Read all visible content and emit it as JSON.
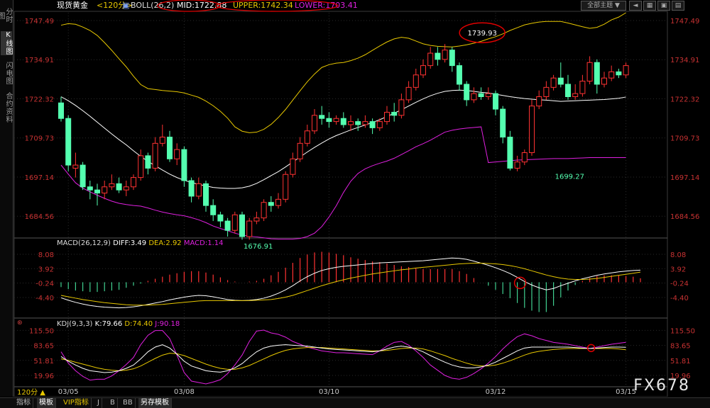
{
  "sidebar": {
    "tabs": [
      {
        "label": "分时图",
        "active": false
      },
      {
        "label": "K线图",
        "active": true
      },
      {
        "label": "闪电图",
        "active": false
      },
      {
        "label": "合约资料",
        "active": false
      }
    ]
  },
  "header": {
    "symbol": "现货黄金",
    "period": "<120分>",
    "indicator": "BOLL(26,2)",
    "mid": "MID:1722.88",
    "upper": "UPPER:1742.34",
    "lower": "LOWER:1703.41",
    "theme_select": "全部主题",
    "colors": {
      "mid": "#ffffff",
      "upper": "#e8c800",
      "lower": "#e020e0",
      "highlight": "#e00000"
    }
  },
  "macd_header": {
    "name": "MACD(26,12,9)",
    "diff": "DIFF:3.49",
    "dea": "DEA:2.92",
    "macd": "MACD:1.14"
  },
  "kdj_header": {
    "name": "KDJ(9,3,3)",
    "k": "K:79.66",
    "d": "D:74.40",
    "j": "J:90.18"
  },
  "bottom": {
    "period_label": "120分",
    "tabs": [
      "指标",
      "模板",
      "VIP指标",
      "J",
      "B",
      "BB",
      "另存模板"
    ]
  },
  "watermark": "FX678",
  "chart_data": [
    {
      "type": "candlestick",
      "title": "现货黄金 <120分> BOLL(26,2)",
      "yticks": [
        "1747.49",
        "1734.91",
        "1722.32",
        "1709.73",
        "1697.14",
        "1684.56"
      ],
      "ylim": [
        1678,
        1750
      ],
      "xticks": [
        {
          "label": "03/05",
          "index": 1
        },
        {
          "label": "03/08",
          "index": 17
        },
        {
          "label": "03/10",
          "index": 37
        },
        {
          "label": "03/12",
          "index": 60
        },
        {
          "label": "03/15",
          "index": 78
        }
      ],
      "annotations": [
        {
          "text": "1739.93",
          "index": 56,
          "value": 1739.93,
          "circled": true
        },
        {
          "text": "1699.27",
          "index": 68,
          "value": 1699.27
        },
        {
          "text": "1676.91",
          "index": 25,
          "value": 1676.91
        }
      ],
      "candles": [
        [
          1721,
          1716,
          1723,
          1715
        ],
        [
          1716,
          1701,
          1717,
          1699
        ],
        [
          1700,
          1701,
          1705,
          1697
        ],
        [
          1701,
          1694,
          1702,
          1693
        ],
        [
          1694,
          1693,
          1696,
          1690
        ],
        [
          1693,
          1692,
          1695,
          1688
        ],
        [
          1692,
          1694,
          1696,
          1690
        ],
        [
          1694,
          1695,
          1698,
          1693
        ],
        [
          1695,
          1693,
          1697,
          1692
        ],
        [
          1693,
          1694,
          1696,
          1691
        ],
        [
          1694,
          1697,
          1698,
          1693
        ],
        [
          1697,
          1704,
          1706,
          1696
        ],
        [
          1704,
          1700,
          1705,
          1698
        ],
        [
          1700,
          1708,
          1710,
          1699
        ],
        [
          1708,
          1710,
          1714,
          1707
        ],
        [
          1710,
          1703,
          1712,
          1702
        ],
        [
          1703,
          1706,
          1708,
          1701
        ],
        [
          1706,
          1696,
          1707,
          1694
        ],
        [
          1696,
          1691,
          1697,
          1689
        ],
        [
          1691,
          1695,
          1697,
          1690
        ],
        [
          1695,
          1688,
          1696,
          1686
        ],
        [
          1688,
          1685,
          1690,
          1683
        ],
        [
          1685,
          1683,
          1686,
          1681
        ],
        [
          1683,
          1680,
          1684,
          1678
        ],
        [
          1680,
          1685,
          1686,
          1679
        ],
        [
          1685,
          1678,
          1686,
          1677
        ],
        [
          1678,
          1683,
          1684,
          1677
        ],
        [
          1683,
          1684,
          1686,
          1682
        ],
        [
          1684,
          1689,
          1690,
          1683
        ],
        [
          1689,
          1688,
          1691,
          1686
        ],
        [
          1688,
          1690,
          1692,
          1687
        ],
        [
          1690,
          1698,
          1699,
          1689
        ],
        [
          1698,
          1703,
          1705,
          1697
        ],
        [
          1703,
          1708,
          1710,
          1702
        ],
        [
          1708,
          1712,
          1714,
          1707
        ],
        [
          1712,
          1717,
          1719,
          1711
        ],
        [
          1717,
          1716,
          1720,
          1714
        ],
        [
          1716,
          1715,
          1718,
          1713
        ],
        [
          1715,
          1716,
          1717,
          1714
        ],
        [
          1716,
          1714,
          1718,
          1713
        ],
        [
          1714,
          1715,
          1717,
          1712
        ],
        [
          1715,
          1714,
          1716,
          1712
        ],
        [
          1714,
          1715,
          1717,
          1713
        ],
        [
          1715,
          1713,
          1716,
          1711
        ],
        [
          1713,
          1715,
          1716,
          1712
        ],
        [
          1715,
          1718,
          1720,
          1714
        ],
        [
          1718,
          1717,
          1721,
          1715
        ],
        [
          1717,
          1722,
          1724,
          1716
        ],
        [
          1722,
          1726,
          1728,
          1721
        ],
        [
          1726,
          1730,
          1732,
          1725
        ],
        [
          1730,
          1733,
          1735,
          1729
        ],
        [
          1733,
          1737,
          1739,
          1732
        ],
        [
          1737,
          1735,
          1739,
          1733
        ],
        [
          1735,
          1738,
          1739.93,
          1734
        ],
        [
          1738,
          1733,
          1739,
          1731
        ],
        [
          1733,
          1727,
          1734,
          1725
        ],
        [
          1727,
          1722,
          1728,
          1720
        ],
        [
          1722,
          1724,
          1726,
          1721
        ],
        [
          1724,
          1723,
          1726,
          1722
        ],
        [
          1723,
          1724,
          1726,
          1722
        ],
        [
          1724,
          1719,
          1725,
          1717
        ],
        [
          1719,
          1710,
          1720,
          1708
        ],
        [
          1710,
          1700,
          1712,
          1699.27
        ],
        [
          1700,
          1702,
          1704,
          1699
        ],
        [
          1702,
          1705,
          1706,
          1701
        ],
        [
          1705,
          1720,
          1722,
          1704
        ],
        [
          1720,
          1723,
          1725,
          1719
        ],
        [
          1723,
          1726,
          1728,
          1722
        ],
        [
          1726,
          1729,
          1730,
          1725
        ],
        [
          1729,
          1727,
          1734,
          1726
        ],
        [
          1727,
          1723,
          1730,
          1722
        ],
        [
          1723,
          1724,
          1727,
          1722
        ],
        [
          1724,
          1728,
          1730,
          1723
        ],
        [
          1728,
          1734,
          1736,
          1727
        ],
        [
          1734,
          1727,
          1735,
          1724
        ],
        [
          1727,
          1729,
          1731,
          1726
        ],
        [
          1729,
          1731,
          1733,
          1728
        ],
        [
          1731,
          1730,
          1732,
          1729
        ],
        [
          1730,
          1733,
          1734,
          1729
        ]
      ],
      "upper": [
        1746,
        1746.5,
        1746.3,
        1745.4,
        1744.3,
        1742.7,
        1740.4,
        1737.9,
        1735.2,
        1732.6,
        1729.6,
        1726.9,
        1725.6,
        1725.3,
        1725,
        1724.8,
        1724.6,
        1724.2,
        1723.5,
        1722.8,
        1721.6,
        1720.1,
        1718.3,
        1716.1,
        1713.3,
        1711.9,
        1711.4,
        1711.6,
        1712.5,
        1714.1,
        1716.3,
        1718.9,
        1721.9,
        1724.9,
        1727.8,
        1730.3,
        1732.4,
        1733.3,
        1733.8,
        1734,
        1734.6,
        1735.4,
        1736.5,
        1737.9,
        1739.3,
        1740.6,
        1741.6,
        1742.1,
        1741.8,
        1740.9,
        1740,
        1739.5,
        1739.2,
        1739.1,
        1739,
        1739.3,
        1739.7,
        1740.2,
        1740.8,
        1741.6,
        1742.3,
        1743.2,
        1744.3,
        1745.2,
        1746.1,
        1746.6,
        1747,
        1747.2,
        1747.2,
        1747.2,
        1746.7,
        1746.1,
        1745.5,
        1745,
        1745.3,
        1746.3,
        1747.7,
        1748.6,
        1750
      ],
      "mid": [
        1723,
        1721.7,
        1720.2,
        1718.5,
        1716.7,
        1714.8,
        1712.9,
        1711,
        1709.2,
        1707.5,
        1705.6,
        1703.8,
        1702.2,
        1700.8,
        1699.4,
        1698.1,
        1697,
        1696.1,
        1695.4,
        1694.8,
        1694.3,
        1693.8,
        1693.6,
        1693.5,
        1693.5,
        1693.7,
        1694.2,
        1695.1,
        1696.3,
        1697.6,
        1698.9,
        1700.4,
        1702,
        1703.6,
        1705.2,
        1706.7,
        1708.1,
        1709.4,
        1710.5,
        1711.4,
        1712.3,
        1713.1,
        1713.9,
        1714.7,
        1715.6,
        1716.6,
        1717.7,
        1718.8,
        1720,
        1721.2,
        1722.3,
        1723.3,
        1724.1,
        1724.7,
        1725,
        1725.1,
        1725,
        1724.7,
        1724.4,
        1724.2,
        1723.8,
        1723.4,
        1723,
        1722.7,
        1722.4,
        1722.2,
        1722,
        1721.9,
        1721.7,
        1721.5,
        1721.6,
        1721.7,
        1721.8,
        1721.9,
        1722,
        1722.1,
        1722.3,
        1722.5,
        1722.9
      ],
      "lower": [
        1701,
        1698.1,
        1695.3,
        1693.6,
        1692.4,
        1691.3,
        1690.3,
        1689.4,
        1688.7,
        1688.3,
        1688,
        1687.8,
        1687.2,
        1686.5,
        1685.9,
        1685.4,
        1685,
        1684.7,
        1684.1,
        1683.4,
        1682.5,
        1681.4,
        1680.6,
        1679.9,
        1679.1,
        1678.5,
        1678.1,
        1677.9,
        1677.6,
        1677.3,
        1677.2,
        1677.2,
        1677.2,
        1677.4,
        1678,
        1679.1,
        1681.2,
        1684.3,
        1687.9,
        1692.2,
        1695.8,
        1698.3,
        1699.8,
        1700.8,
        1701.6,
        1702.3,
        1703.2,
        1704.4,
        1705.6,
        1706.9,
        1707.9,
        1709,
        1710.3,
        1711.6,
        1712.2,
        1712.6,
        1712.9,
        1713.1,
        1713.3,
        1701.8,
        1702,
        1702.2,
        1702.4,
        1702.6,
        1702.7,
        1702.8,
        1702.9,
        1703,
        1703.1,
        1703.1,
        1703.1,
        1703.2,
        1703.3,
        1703.4,
        1703.4,
        1703.4,
        1703.4,
        1703.4,
        1703.41
      ]
    },
    {
      "type": "macd",
      "title": "MACD(26,12,9)",
      "yticks": [
        "8.08",
        "3.92",
        "-0.24",
        "-4.40"
      ],
      "ylim": [
        -8.5,
        9.5
      ],
      "diff": [
        -4.5,
        -5.2,
        -5.8,
        -6.3,
        -6.7,
        -7,
        -7.2,
        -7.3,
        -7.4,
        -7.3,
        -7.1,
        -6.8,
        -6.4,
        -6,
        -5.6,
        -5.1,
        -4.7,
        -4.3,
        -4,
        -3.8,
        -3.9,
        -4.2,
        -4.6,
        -5,
        -5.2,
        -5.3,
        -5.2,
        -5,
        -4.6,
        -4,
        -3.2,
        -2.2,
        -1,
        0.4,
        1.6,
        2.6,
        3.4,
        3.9,
        4.3,
        4.6,
        4.8,
        5,
        5.2,
        5.4,
        5.6,
        5.7,
        5.8,
        5.9,
        6,
        6.1,
        6.2,
        6.4,
        6.6,
        6.8,
        7,
        6.9,
        6.6,
        6.1,
        5.5,
        4.9,
        4.2,
        3.4,
        2.5,
        1.4,
        0.2,
        -0.8,
        -1.6,
        -2.2,
        -1.8,
        -1,
        -0.3,
        0.4,
        1,
        1.5,
        2,
        2.4,
        2.7,
        3,
        3.2,
        3.4,
        3.49
      ],
      "dea": [
        -3.8,
        -4.2,
        -4.6,
        -5,
        -5.3,
        -5.6,
        -5.9,
        -6.1,
        -6.3,
        -6.5,
        -6.6,
        -6.6,
        -6.6,
        -6.5,
        -6.4,
        -6.2,
        -6,
        -5.8,
        -5.6,
        -5.4,
        -5.3,
        -5.3,
        -5.3,
        -5.3,
        -5.3,
        -5.3,
        -5.3,
        -5.2,
        -5.1,
        -5,
        -4.7,
        -4.3,
        -3.8,
        -3.1,
        -2.4,
        -1.7,
        -1,
        -0.4,
        0.2,
        0.7,
        1.2,
        1.6,
        2,
        2.4,
        2.7,
        3,
        3.3,
        3.6,
        3.8,
        4.1,
        4.3,
        4.5,
        4.7,
        4.9,
        5.1,
        5.3,
        5.4,
        5.5,
        5.5,
        5.4,
        5.3,
        5.1,
        4.8,
        4.4,
        3.9,
        3.3,
        2.7,
        2.1,
        1.6,
        1.2,
        0.9,
        0.8,
        0.8,
        0.9,
        1.1,
        1.4,
        1.7,
        2,
        2.3,
        2.6,
        2.92
      ],
      "hist": [
        -1.4,
        -2,
        -2.4,
        -2.6,
        -2.8,
        -2.8,
        -2.6,
        -2.4,
        -2.2,
        -1.6,
        -1,
        -0.4,
        0.4,
        1,
        1.6,
        2.2,
        2.6,
        3,
        3.2,
        3.2,
        2.8,
        2.2,
        1.4,
        0.6,
        0.2,
        0,
        0.2,
        0.4,
        1,
        2,
        3,
        4.2,
        5.6,
        7,
        8,
        8.6,
        8.8,
        8.6,
        8.2,
        7.8,
        7.2,
        6.8,
        6.4,
        6,
        5.8,
        5.4,
        5,
        4.6,
        4.4,
        4,
        3.8,
        3.8,
        3.8,
        3.8,
        3.8,
        3.2,
        2.4,
        1.2,
        0,
        -1,
        -2.2,
        -3.4,
        -4.6,
        -6,
        -7.4,
        -8.2,
        -8.6,
        -8.6,
        -6.8,
        -4.4,
        -2.4,
        -0.8,
        0.4,
        1.2,
        1.8,
        2,
        2,
        2,
        1.8,
        1.6,
        1.14
      ]
    },
    {
      "type": "kdj",
      "title": "KDJ(9,3,3)",
      "yticks": [
        "115.50",
        "83.65",
        "51.81",
        "19.96"
      ],
      "ylim": [
        5,
        125
      ],
      "k": [
        60,
        50,
        42,
        35,
        30,
        28,
        26,
        27,
        30,
        35,
        42,
        55,
        70,
        80,
        85,
        78,
        65,
        50,
        40,
        35,
        30,
        28,
        27,
        30,
        36,
        45,
        58,
        70,
        78,
        82,
        84,
        85,
        84,
        83,
        82,
        80,
        78,
        76,
        75,
        74,
        73,
        72,
        71,
        70,
        72,
        76,
        80,
        82,
        80,
        76,
        70,
        62,
        55,
        48,
        42,
        38,
        36,
        36,
        38,
        42,
        48,
        56,
        64,
        72,
        78,
        80,
        80,
        80,
        80,
        80,
        80,
        79,
        78,
        77,
        78,
        79,
        80,
        80,
        79.66
      ],
      "d": [
        55,
        52,
        48,
        44,
        40,
        36,
        33,
        31,
        30,
        31,
        34,
        40,
        48,
        56,
        63,
        67,
        66,
        62,
        56,
        50,
        44,
        39,
        35,
        33,
        33,
        36,
        41,
        48,
        55,
        62,
        68,
        73,
        76,
        78,
        79,
        79,
        79,
        78,
        77,
        76,
        75,
        74,
        73,
        72,
        72,
        73,
        75,
        77,
        78,
        78,
        76,
        72,
        67,
        62,
        56,
        51,
        46,
        42,
        40,
        40,
        42,
        46,
        51,
        57,
        63,
        68,
        71,
        73,
        75,
        76,
        77,
        77,
        77,
        77,
        77,
        77,
        77,
        76,
        74.4
      ],
      "j": [
        70,
        46,
        30,
        18,
        10,
        12,
        12,
        19,
        30,
        43,
        58,
        85,
        105,
        115,
        115,
        98,
        63,
        26,
        8,
        5,
        2,
        6,
        11,
        24,
        42,
        63,
        92,
        114,
        116,
        110,
        107,
        101,
        92,
        86,
        80,
        76,
        72,
        70,
        68,
        68,
        67,
        66,
        65,
        64,
        72,
        82,
        90,
        92,
        84,
        72,
        58,
        42,
        31,
        20,
        14,
        12,
        16,
        24,
        34,
        46,
        60,
        76,
        90,
        102,
        108,
        104,
        98,
        94,
        90,
        88,
        86,
        83,
        80,
        77,
        80,
        83,
        86,
        88,
        90.18
      ]
    }
  ]
}
